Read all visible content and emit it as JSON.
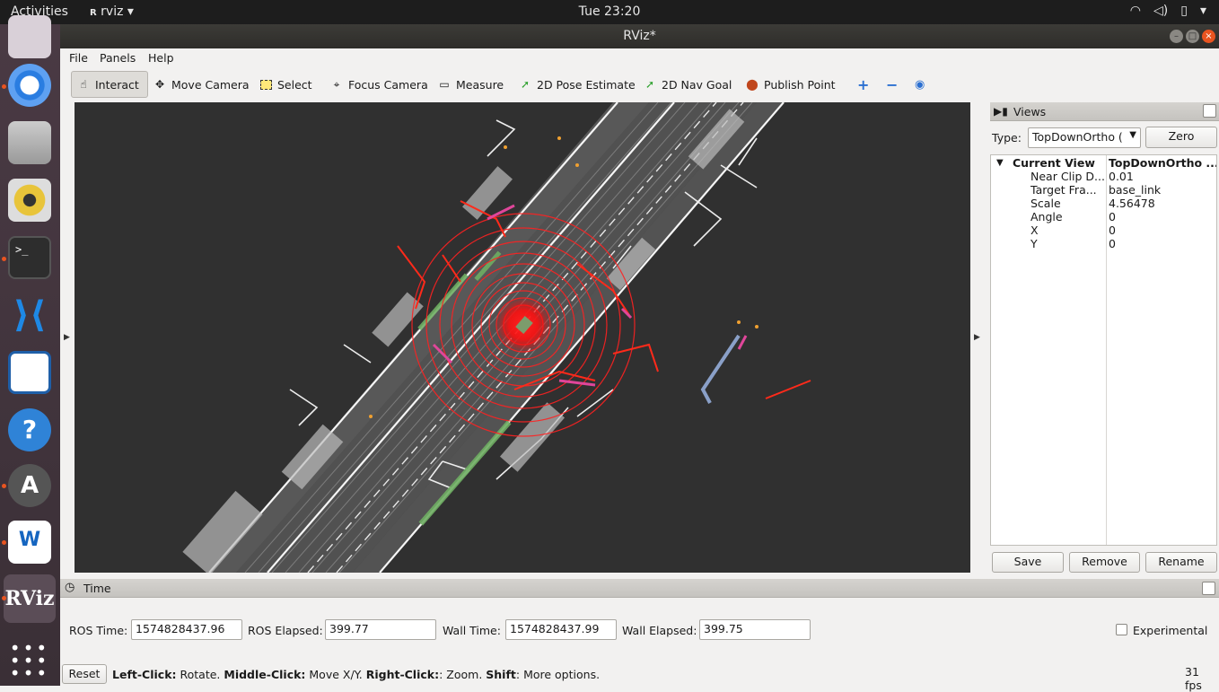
{
  "topbar": {
    "activities": "Activities",
    "app_menu": "rviz",
    "clock": "Tue 23:20"
  },
  "window": {
    "title": "RViz*"
  },
  "menu": [
    "File",
    "Panels",
    "Help"
  ],
  "toolbar": {
    "interact": "Interact",
    "move_camera": "Move Camera",
    "select": "Select",
    "focus_camera": "Focus Camera",
    "measure": "Measure",
    "pose_estimate": "2D Pose Estimate",
    "nav_goal": "2D Nav Goal",
    "publish_point": "Publish Point"
  },
  "views": {
    "title": "Views",
    "type_label": "Type:",
    "type_value": "TopDownOrtho (",
    "zero_button": "Zero",
    "current_view_label": "Current View",
    "current_view_value": "TopDownOrtho ...",
    "properties": [
      {
        "key": "Near Clip D...",
        "value": "0.01"
      },
      {
        "key": "Target Fra...",
        "value": "base_link"
      },
      {
        "key": "Scale",
        "value": "4.56478"
      },
      {
        "key": "Angle",
        "value": "0"
      },
      {
        "key": "X",
        "value": "0"
      },
      {
        "key": "Y",
        "value": "0"
      }
    ],
    "save": "Save",
    "remove": "Remove",
    "rename": "Rename"
  },
  "time": {
    "title": "Time",
    "ros_time_label": "ROS Time:",
    "ros_time": "1574828437.96",
    "ros_elapsed_label": "ROS Elapsed:",
    "ros_elapsed": "399.77",
    "wall_time_label": "Wall Time:",
    "wall_time": "1574828437.99",
    "wall_elapsed_label": "Wall Elapsed:",
    "wall_elapsed": "399.75",
    "experimental": "Experimental"
  },
  "statusbar": {
    "reset": "Reset",
    "left_click": "Left-Click:",
    "left_action": " Rotate. ",
    "middle_click": "Middle-Click:",
    "middle_action": " Move X/Y. ",
    "right_click": "Right-Click:",
    "right_action": ": Zoom. ",
    "shift": "Shift",
    "shift_action": ": More options.",
    "fps": "31 fps"
  },
  "launcher_icons": [
    "mail-icon",
    "chromium-icon",
    "files-icon",
    "speaker-icon",
    "terminal-icon",
    "vscode-icon",
    "document-viewer-icon",
    "help-icon",
    "software-updater-icon",
    "autoware-icon",
    "rviz-icon",
    "app-grid-icon"
  ],
  "colors": {
    "accent": "#e95420",
    "viewport_bg": "#303030",
    "lidar_red": "#ff1a1a",
    "pointcloud": "#d0d0d0"
  }
}
